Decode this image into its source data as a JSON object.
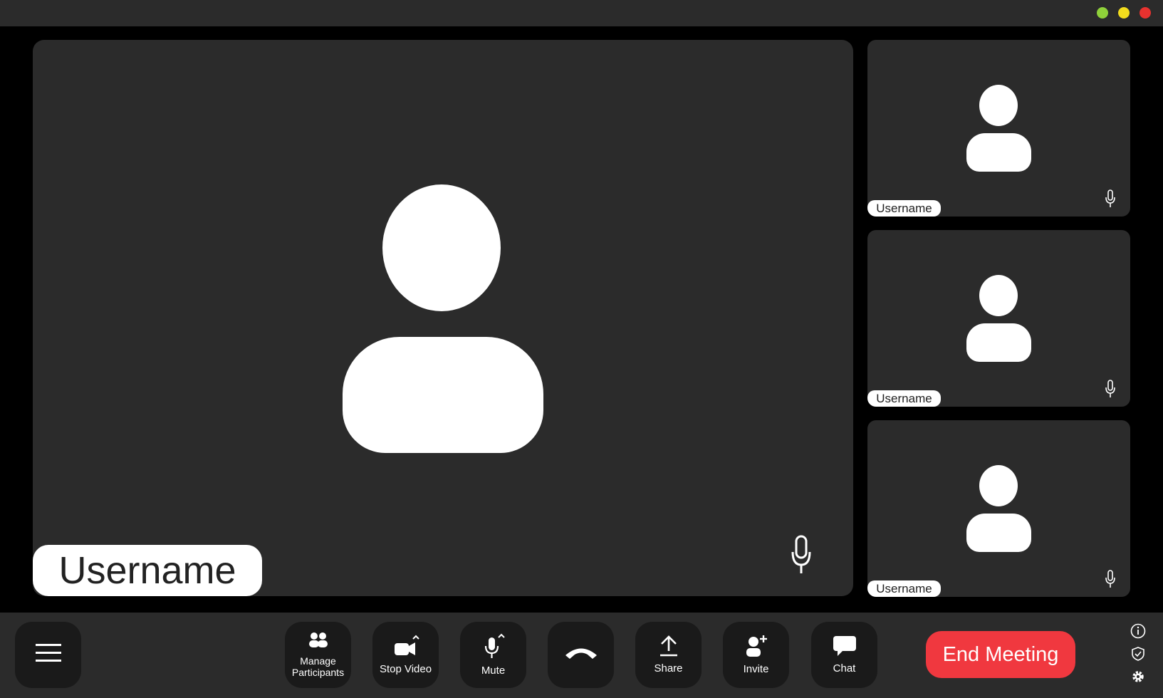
{
  "window": {
    "controls": [
      {
        "name": "minimize",
        "color": "#8fd13a"
      },
      {
        "name": "maximize",
        "color": "#f2dc1d"
      },
      {
        "name": "close",
        "color": "#e8322f"
      }
    ]
  },
  "main_video": {
    "username": "Username",
    "mic_icon": "microphone-icon"
  },
  "thumbnails": [
    {
      "username": "Username",
      "mic_icon": "microphone-icon"
    },
    {
      "username": "Username",
      "mic_icon": "microphone-icon"
    },
    {
      "username": "Username",
      "mic_icon": "microphone-icon"
    }
  ],
  "toolbar": {
    "menu_icon": "hamburger-menu-icon",
    "manage_participants_label": "Manage\nParticipants",
    "stop_video_label": "Stop Video",
    "mute_label": "Mute",
    "hangup_icon": "phone-hangup-icon",
    "share_label": "Share",
    "invite_label": "Invite",
    "chat_label": "Chat",
    "end_meeting_label": "End Meeting",
    "end_meeting_color": "#f0383f"
  },
  "side_icons": [
    "info-icon",
    "shield-icon",
    "gear-icon"
  ],
  "colors": {
    "background": "#000000",
    "panel": "#2b2b2b",
    "button": "#1a1a1a"
  }
}
